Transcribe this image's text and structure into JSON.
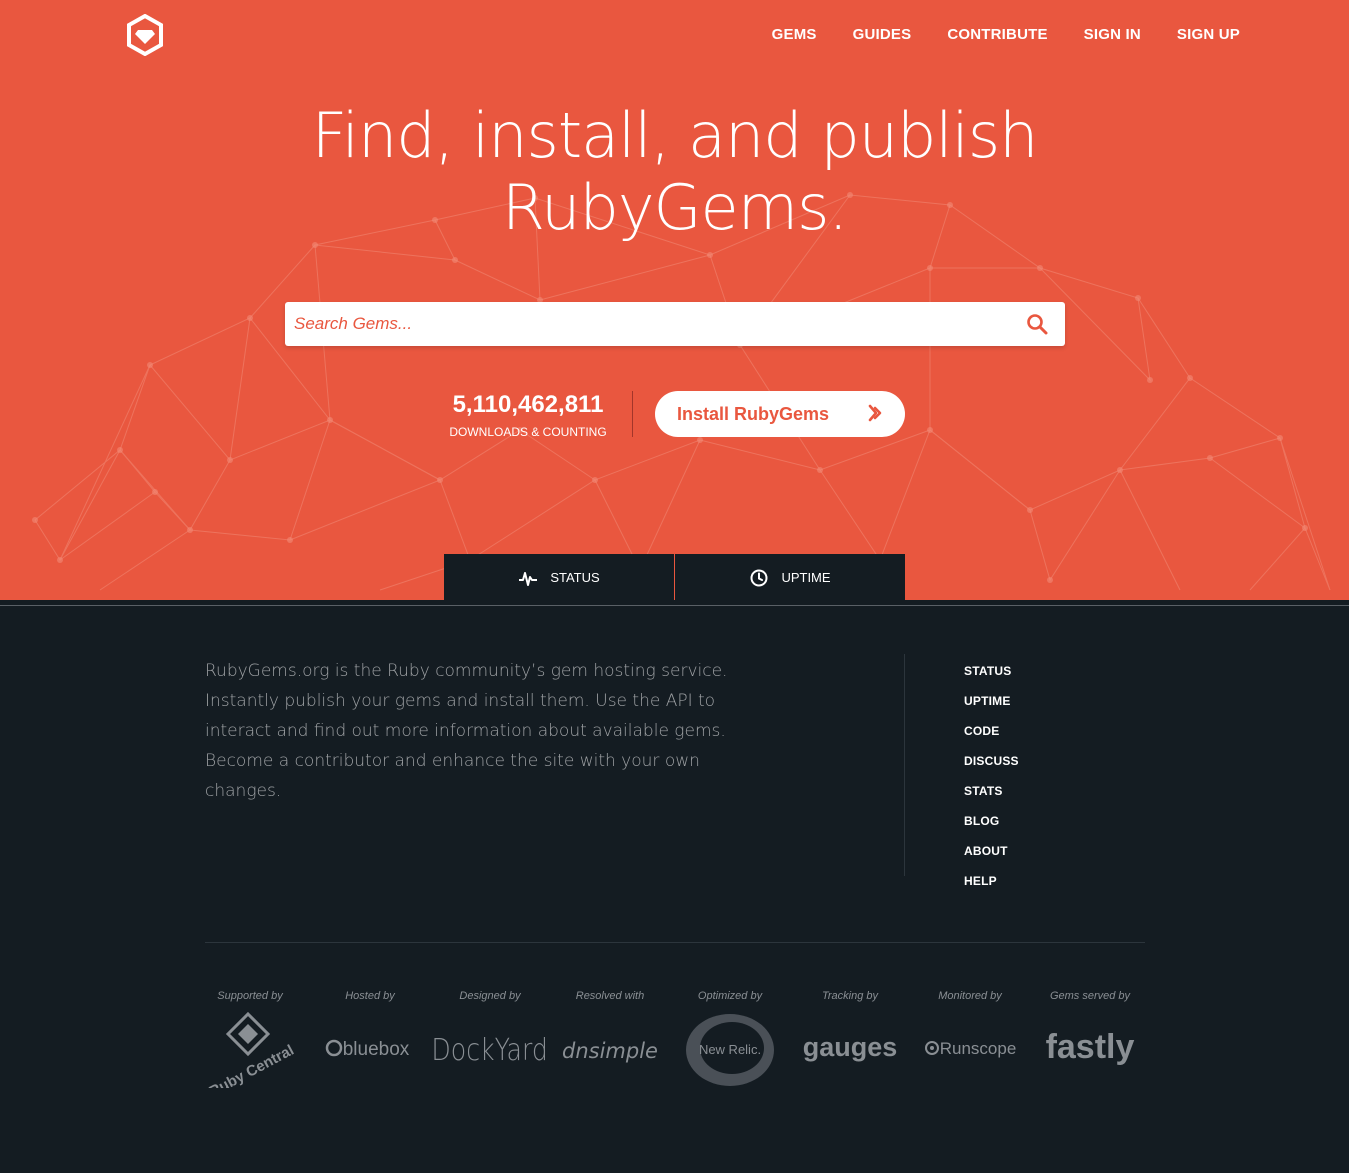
{
  "nav": {
    "links": [
      "GEMS",
      "GUIDES",
      "CONTRIBUTE",
      "SIGN IN",
      "SIGN UP"
    ]
  },
  "hero": {
    "headline_line1": "Find, install, and publish",
    "headline_line2": "RubyGems.",
    "search_placeholder": "Search Gems...",
    "downloads_count": "5,110,462,811",
    "downloads_label": "DOWNLOADS & COUNTING",
    "install_label": "Install RubyGems"
  },
  "tabs": {
    "status": "STATUS",
    "uptime": "UPTIME"
  },
  "footer": {
    "about": "RubyGems.org is the Ruby community’s gem hosting service. Instantly publish your gems and install them. Use the API to interact and find out more information about available gems. Become a contributor and enhance the site with your own changes.",
    "links": [
      "STATUS",
      "UPTIME",
      "CODE",
      "DISCUSS",
      "STATS",
      "BLOG",
      "ABOUT",
      "HELP"
    ],
    "sponsors": [
      {
        "caption": "Supported by",
        "name": "Ruby Central"
      },
      {
        "caption": "Hosted by",
        "name": "bluebox"
      },
      {
        "caption": "Designed by",
        "name": "DockYard"
      },
      {
        "caption": "Resolved with",
        "name": "dnsimple"
      },
      {
        "caption": "Optimized by",
        "name": "New Relic."
      },
      {
        "caption": "Tracking by",
        "name": "gauges"
      },
      {
        "caption": "Monitored by",
        "name": "Runscope"
      },
      {
        "caption": "Gems served by",
        "name": "fastly"
      }
    ]
  },
  "colors": {
    "brand": "#e9573f",
    "dark": "#141c22"
  }
}
